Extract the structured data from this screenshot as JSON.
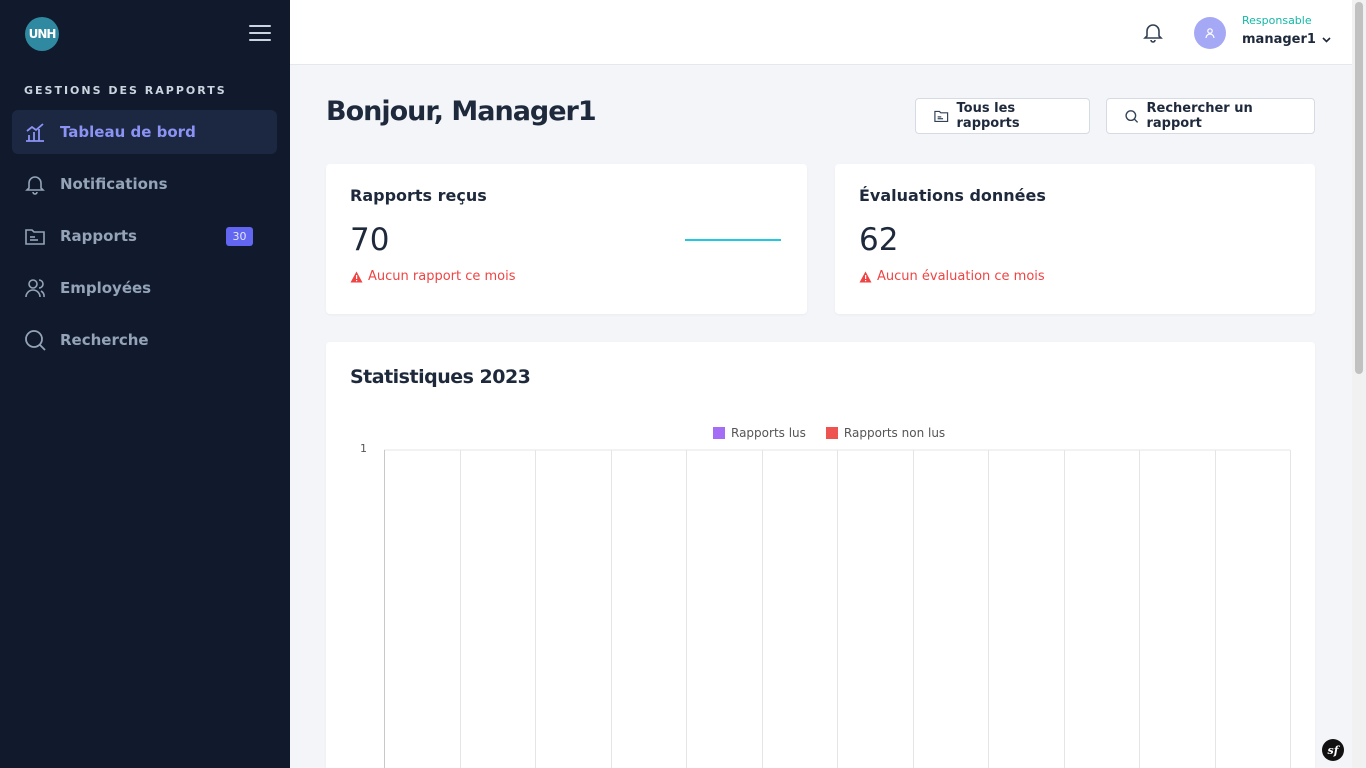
{
  "brand": {
    "logo_text": "UNH"
  },
  "sidebar": {
    "section_title": "GESTIONS DES RAPPORTS",
    "items": [
      {
        "label": "Tableau de bord",
        "icon": "chart-bar-icon",
        "active": true
      },
      {
        "label": "Notifications",
        "icon": "bell-icon"
      },
      {
        "label": "Rapports",
        "icon": "folder-icon",
        "badge": "30"
      },
      {
        "label": "Employées",
        "icon": "users-icon"
      },
      {
        "label": "Recherche",
        "icon": "search-icon"
      }
    ]
  },
  "topbar": {
    "role": "Responsable",
    "username": "manager1"
  },
  "main": {
    "greeting": "Bonjour, Manager1",
    "buttons": {
      "all_reports": "Tous les rapports",
      "search_report": "Rechercher un rapport"
    },
    "cards": [
      {
        "title": "Rapports reçus",
        "value": "70",
        "alert": "Aucun rapport ce mois"
      },
      {
        "title": "Évaluations données",
        "value": "62",
        "alert": "Aucun évaluation ce mois"
      }
    ],
    "stats_title": "Statistiques 2023"
  },
  "colors": {
    "sidebar": "#101a2c",
    "accent": "#6366f1",
    "read": "#a855f7",
    "unread": "#ef5350",
    "alert": "#ef4444",
    "role": "#14b8a6"
  },
  "chart_data": {
    "type": "bar",
    "categories": [
      "",
      "",
      "",
      "",
      "",
      "",
      "",
      "",
      "",
      "",
      "",
      ""
    ],
    "series": [
      {
        "name": "Rapports lus",
        "values": []
      },
      {
        "name": "Rapports non lus",
        "values": []
      }
    ],
    "yticks": [
      "1"
    ],
    "grid": true,
    "legend": "top-center"
  },
  "footer": {
    "symfony_badge": "sf"
  }
}
